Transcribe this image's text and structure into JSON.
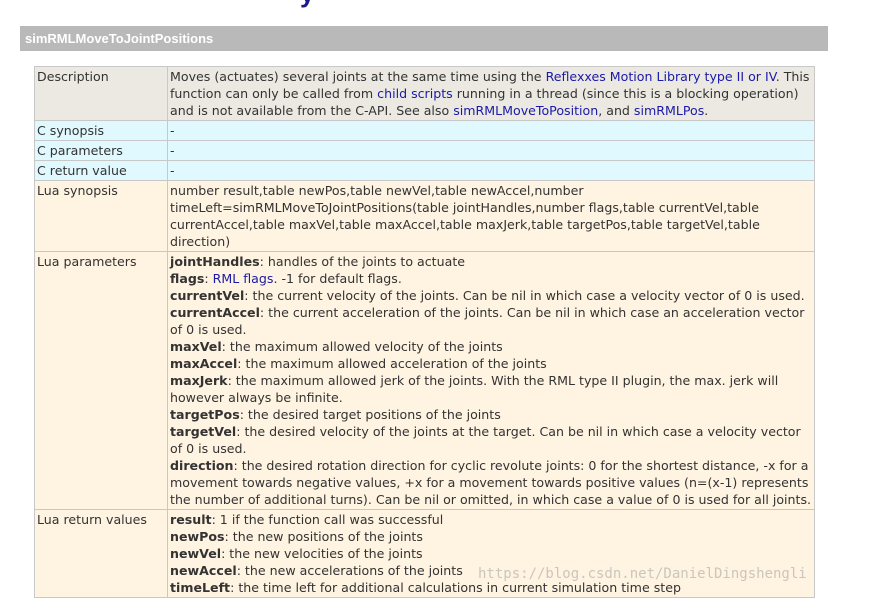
{
  "section_title": "simRMLMoveToJointPositions",
  "description": {
    "label": "Description",
    "parts": [
      {
        "text": "Moves (actuates) several joints at the same time using the ",
        "link": false
      },
      {
        "text": "Reflexxes Motion Library type II or IV",
        "link": true
      },
      {
        "text": ". This function can only be called from ",
        "link": false
      },
      {
        "text": "child scripts",
        "link": true
      },
      {
        "text": " running in a thread (since this is a blocking operation) and is not available from the C-API. See also ",
        "link": false
      },
      {
        "text": "simRMLMoveToPosition",
        "link": true
      },
      {
        "text": ", and ",
        "link": false
      },
      {
        "text": "simRMLPos",
        "link": true
      },
      {
        "text": ".",
        "link": false
      }
    ]
  },
  "c_synopsis": {
    "label": "C synopsis",
    "value": "-"
  },
  "c_parameters": {
    "label": "C parameters",
    "value": "-"
  },
  "c_return_value": {
    "label": "C return value",
    "value": "-"
  },
  "lua_synopsis": {
    "label": "Lua synopsis",
    "value": "number result,table newPos,table newVel,table newAccel,number timeLeft=simRMLMoveToJointPositions(table jointHandles,number flags,table currentVel,table currentAccel,table maxVel,table maxAccel,table maxJerk,table targetPos,table targetVel,table direction)"
  },
  "lua_parameters": {
    "label": "Lua parameters",
    "items": [
      {
        "name": "jointHandles",
        "desc": ": handles of the joints to actuate"
      },
      {
        "name": "flags",
        "desc": ": ",
        "link": "RML flags",
        "after": ". -1 for default flags."
      },
      {
        "name": "currentVel",
        "desc": ": the current velocity of the joints. Can be nil in which case a velocity vector of 0 is used."
      },
      {
        "name": "currentAccel",
        "desc": ": the current acceleration of the joints. Can be nil in which case an acceleration vector of 0 is used."
      },
      {
        "name": "maxVel",
        "desc": ": the maximum allowed velocity of the joints"
      },
      {
        "name": "maxAccel",
        "desc": ": the maximum allowed acceleration of the joints"
      },
      {
        "name": "maxJerk",
        "desc": ": the maximum allowed jerk of the joints. With the RML type II plugin, the max. jerk will however always be infinite."
      },
      {
        "name": "targetPos",
        "desc": ": the desired target positions of the joints"
      },
      {
        "name": "targetVel",
        "desc": ": the desired velocity of the joints at the target. Can be nil in which case a velocity vector of 0 is used."
      },
      {
        "name": "direction",
        "desc": ": the desired rotation direction for cyclic revolute joints: 0 for the shortest distance, -x for a movement towards negative values, +x for a movement towards positive values (n=(x-1) represents the number of additional turns). Can be nil or omitted, in which case a value of 0 is used for all joints."
      }
    ]
  },
  "lua_return_values": {
    "label": "Lua return values",
    "items": [
      {
        "name": "result",
        "desc": ": 1 if the function call was successful"
      },
      {
        "name": "newPos",
        "desc": ": the new positions of the joints"
      },
      {
        "name": "newVel",
        "desc": ": the new velocities of the joints"
      },
      {
        "name": "newAccel",
        "desc": ": the new accelerations of the joints"
      },
      {
        "name": "timeLeft",
        "desc": ": the time left for additional calculations in current simulation time step"
      }
    ]
  },
  "watermark": "https://blog.csdn.net/DanielDingshengli",
  "colors": {
    "header_bar": "#b9b9b9",
    "description_row": "#ece9e2",
    "c_rows": "#dff9ff",
    "lua_rows": "#fff3e1",
    "link": "#1a1aa6"
  }
}
